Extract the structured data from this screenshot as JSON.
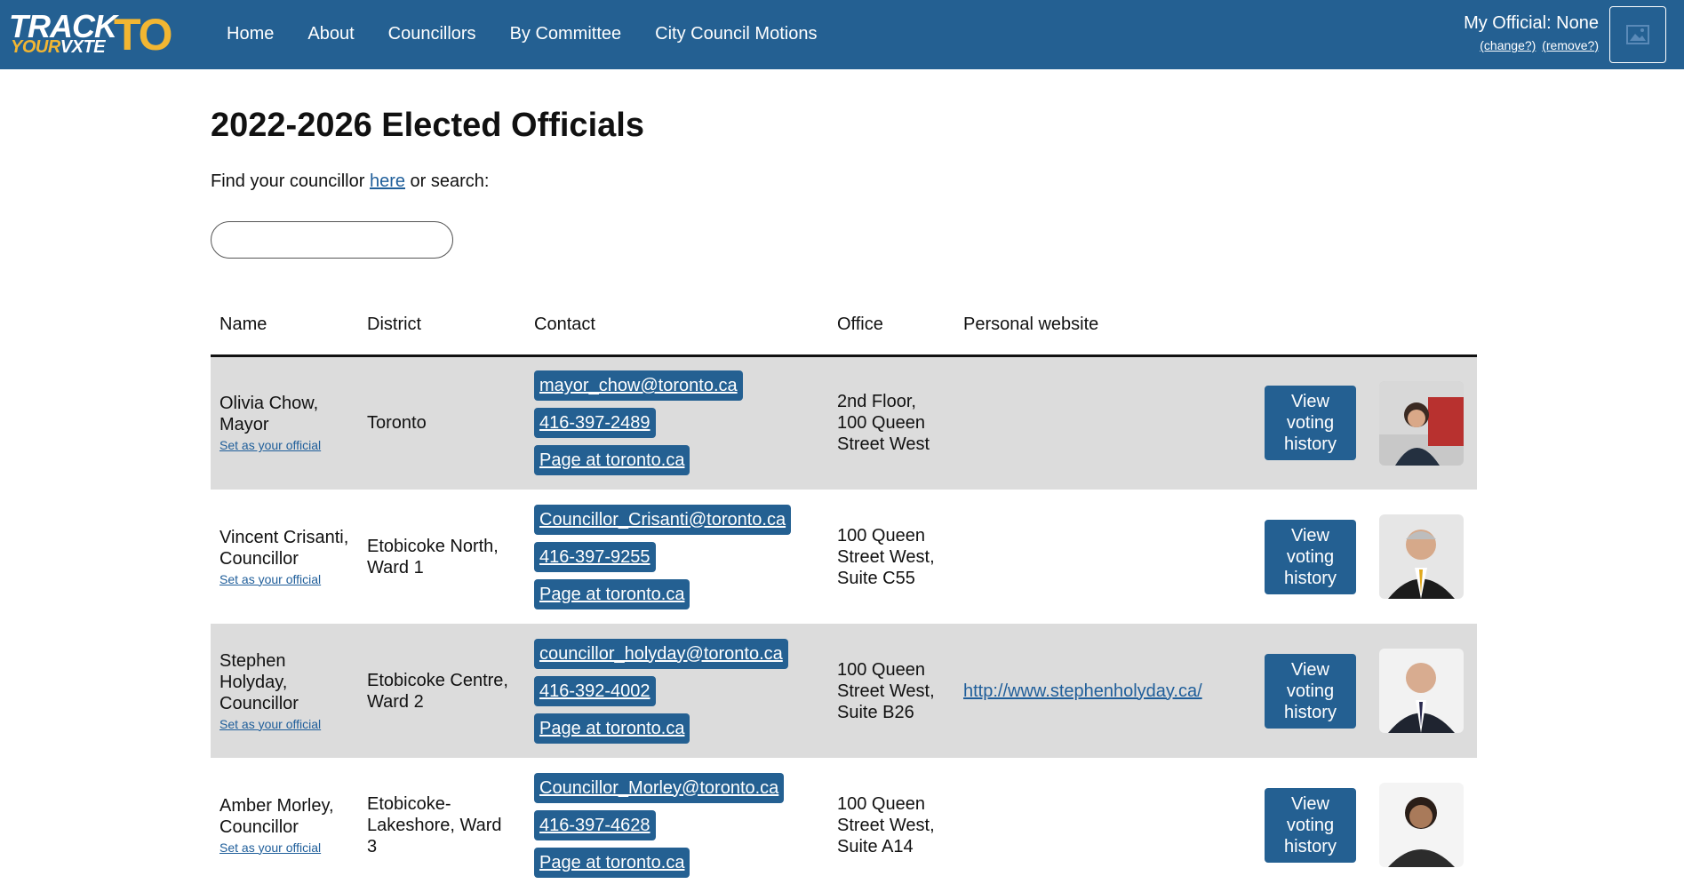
{
  "header": {
    "logo": {
      "track": "TRACK",
      "your": "YOUR",
      "vote": "V",
      "vote_x": "X",
      "vote_end": "TE",
      "to": "TO"
    },
    "nav": [
      "Home",
      "About",
      "Councillors",
      "By Committee",
      "City Council Motions"
    ],
    "my_official": "My Official: None",
    "change_link": "(change?)",
    "remove_link": "(remove?)"
  },
  "page": {
    "title": "2022-2026 Elected Officials",
    "find_prefix": "Find your councillor ",
    "find_link": "here",
    "find_suffix": " or search:",
    "search_value": ""
  },
  "table": {
    "headers": [
      "Name",
      "District",
      "Contact",
      "Office",
      "Personal website"
    ],
    "set_official_label": "Set as your official",
    "vote_button_label": "View voting history",
    "rows": [
      {
        "name": "Olivia Chow,",
        "role": "Mayor",
        "district": "Toronto",
        "email": "mayor_chow@toronto.ca",
        "phone": "416-397-2489",
        "page": "Page at toronto.ca",
        "office": "2nd Floor, 100 Queen Street West",
        "website": "",
        "photo_bg": "#a23a3a"
      },
      {
        "name": "Vincent Crisanti,",
        "role": "Councillor",
        "district": "Etobicoke North, Ward 1",
        "email": "Councillor_Crisanti@toronto.ca",
        "phone": "416-397-9255",
        "page": "Page at toronto.ca",
        "office": "100 Queen Street West, Suite C55",
        "website": "",
        "photo_bg": "#e6e6e6"
      },
      {
        "name": "Stephen Holyday,",
        "role": "Councillor",
        "district": "Etobicoke Centre, Ward 2",
        "email": "councillor_holyday@toronto.ca",
        "phone": "416-392-4002",
        "page": "Page at toronto.ca",
        "office": "100 Queen Street West, Suite B26",
        "website": "http://www.stephenholyday.ca/",
        "photo_bg": "#f2f2f2"
      },
      {
        "name": "Amber Morley,",
        "role": "Councillor",
        "district": "Etobicoke-Lakeshore, Ward 3",
        "email": "Councillor_Morley@toronto.ca",
        "phone": "416-397-4628",
        "page": "Page at toronto.ca",
        "office": "100 Queen Street West, Suite A14",
        "website": "",
        "photo_bg": "#f4f4f4"
      }
    ]
  },
  "colors": {
    "header_bg": "#246092",
    "accent_yellow": "#f2b632",
    "row_shade": "#dcdcdc",
    "link": "#1f5e9a"
  }
}
